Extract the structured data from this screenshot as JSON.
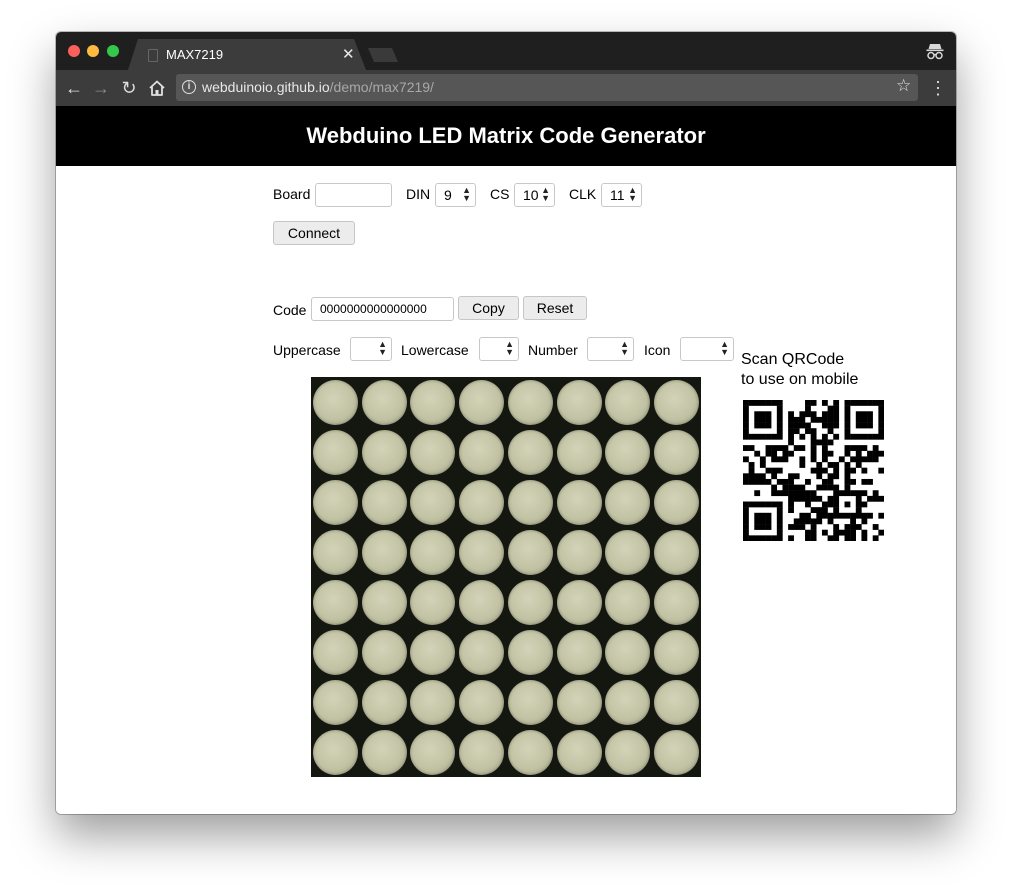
{
  "browser": {
    "tab_title": "MAX7219",
    "url_host": "webduinoio.github.io",
    "url_path": "/demo/max7219/"
  },
  "page": {
    "title": "Webduino LED Matrix Code Generator",
    "board": {
      "label": "Board",
      "value": ""
    },
    "din": {
      "label": "DIN",
      "value": "9"
    },
    "cs": {
      "label": "CS",
      "value": "10"
    },
    "clk": {
      "label": "CLK",
      "value": "11"
    },
    "connect_label": "Connect",
    "code": {
      "label": "Code",
      "value": "0000000000000000"
    },
    "copy_label": "Copy",
    "reset_label": "Reset",
    "uppercase_label": "Uppercase",
    "lowercase_label": "Lowercase",
    "number_label": "Number",
    "icon_label": "Icon",
    "qr_line1": "Scan QRCode",
    "qr_line2": "to use on mobile"
  },
  "matrix": {
    "rows": 8,
    "cols": 8,
    "code": "0000000000000000"
  },
  "colors": {
    "led_off": "#c2c2a4",
    "matrix_bg": "#13170f",
    "header_bg": "#000000"
  }
}
